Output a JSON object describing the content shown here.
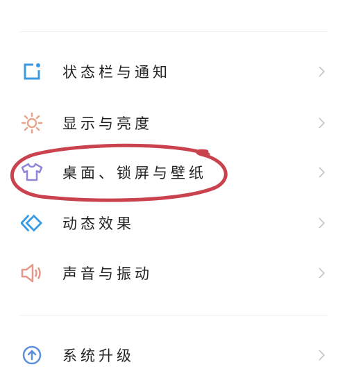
{
  "settings": {
    "items": [
      {
        "label": "状态栏与通知",
        "icon": "status-bar-icon",
        "color": "#3a9be0"
      },
      {
        "label": "显示与亮度",
        "icon": "sun-icon",
        "color": "#e8a58c"
      },
      {
        "label": "桌面、锁屏与壁纸",
        "icon": "tshirt-icon",
        "color": "#8f86d6"
      },
      {
        "label": "动态效果",
        "icon": "diamonds-icon",
        "color": "#3a9be0"
      },
      {
        "label": "声音与振动",
        "icon": "speaker-icon",
        "color": "#e59787"
      },
      {
        "label": "系统升级",
        "icon": "upgrade-arrow-icon",
        "color": "#5b8fdc"
      }
    ]
  },
  "annotation": {
    "color": "#c9424e",
    "shape": "hand-drawn ellipse around 桌面、锁屏与壁纸"
  }
}
